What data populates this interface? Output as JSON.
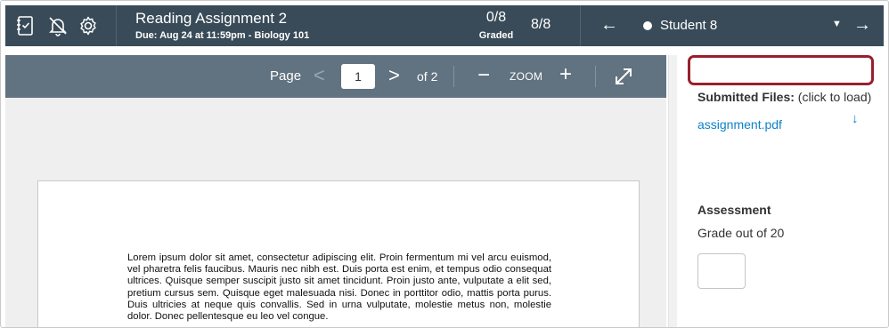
{
  "header": {
    "title": "Reading Assignment 2",
    "due": "Due: Aug 24 at 11:59pm - Biology 101",
    "graded_count": "0/8",
    "graded_label": "Graded",
    "submissions_count": "8/8",
    "prev_arrow": "←",
    "next_arrow": "→",
    "student_name": "Student 8",
    "student_caret": "▼",
    "icons": [
      "gradebook-icon",
      "mute-bell-icon",
      "settings-gear-icon"
    ]
  },
  "doc_toolbar": {
    "page_label": "Page",
    "prev_glyph": "<",
    "page_value": "1",
    "next_glyph": ">",
    "of_pages": "of 2",
    "zoom_minus": "−",
    "zoom_label": "ZOOM",
    "zoom_plus": "+",
    "expand_icon": "expand-icon"
  },
  "document": {
    "text": "Lorem ipsum dolor sit amet, consectetur adipiscing elit. Proin fermentum mi vel arcu euismod, vel pharetra felis faucibus. Mauris nec nibh est. Duis porta est enim, et tempus odio consequat ultrices. Quisque semper suscipit justo sit amet tincidunt. Proin justo ante, vulputate a elit sed, pretium cursus sem. Quisque eget malesuada nisi. Donec in porttitor odio, mattis porta purus. Duis ultricies at neque quis convallis. Sed in urna vulputate, molestie metus non, molestie dolor. Donec pellentesque eu leo vel congue."
  },
  "sidebar": {
    "submitted_label": "Submitted Files:",
    "submitted_hint": " (click to load)",
    "file_name": "assignment.pdf",
    "download_glyph": "↓",
    "assessment_title": "Assessment",
    "grade_out_of": "Grade out of 20",
    "grade_value": ""
  },
  "colors": {
    "topbar": "#394b58",
    "doc_toolbar": "#617280",
    "link": "#0e82c7",
    "highlight_border": "#98202b"
  }
}
